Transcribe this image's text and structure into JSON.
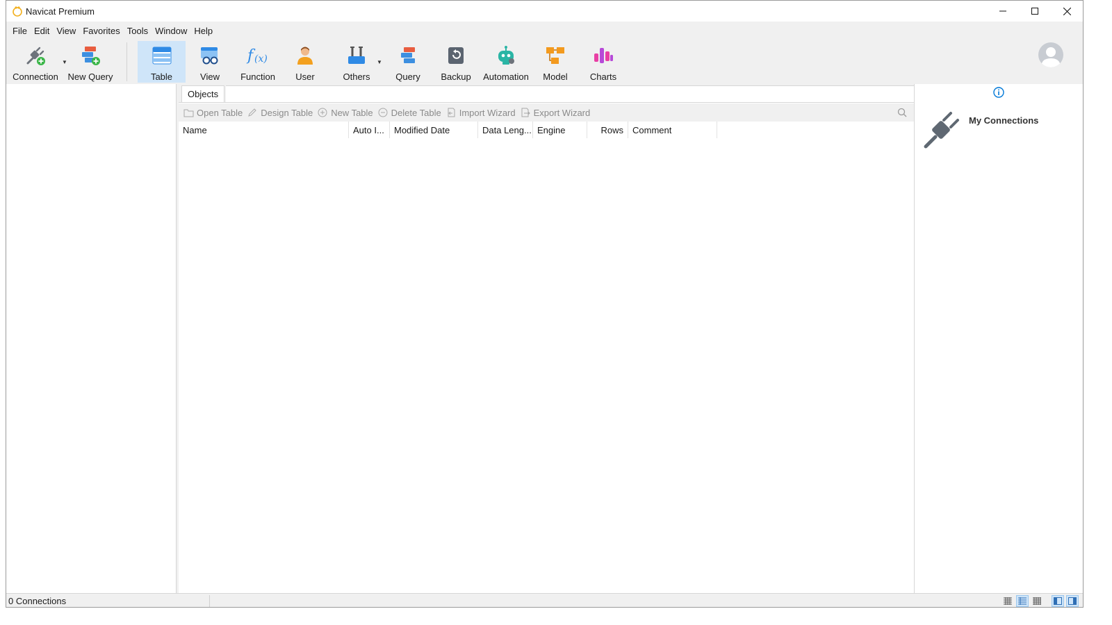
{
  "window": {
    "title": "Navicat Premium"
  },
  "menu": [
    "File",
    "Edit",
    "View",
    "Favorites",
    "Tools",
    "Window",
    "Help"
  ],
  "toolbar": {
    "connection": "Connection",
    "new_query": "New Query",
    "table": "Table",
    "view": "View",
    "function": "Function",
    "user": "User",
    "others": "Others",
    "query": "Query",
    "backup": "Backup",
    "automation": "Automation",
    "model": "Model",
    "charts": "Charts",
    "active": "Table"
  },
  "tabs": {
    "objects": "Objects"
  },
  "object_toolbar": {
    "open_table": "Open Table",
    "design_table": "Design Table",
    "new_table": "New Table",
    "delete_table": "Delete Table",
    "import_wizard": "Import Wizard",
    "export_wizard": "Export Wizard"
  },
  "table": {
    "columns": [
      "Name",
      "Auto I...",
      "Modified Date",
      "Data Leng...",
      "Engine",
      "Rows",
      "Comment"
    ],
    "rows": []
  },
  "right_panel": {
    "title": "My Connections"
  },
  "status": {
    "connections": "0 Connections"
  },
  "colors": {
    "accent": "#0078d7",
    "active_tool": "#cfe5f9"
  }
}
